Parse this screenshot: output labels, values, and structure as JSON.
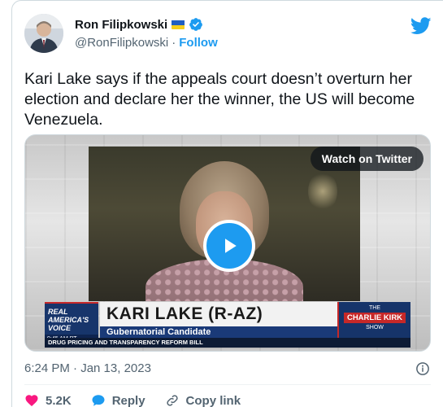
{
  "author": {
    "name": "Ron Filipkowski",
    "handle": "@RonFilipkowski",
    "separator": "·",
    "follow_label": "Follow"
  },
  "tweet": {
    "text": "Kari Lake says if the appeals court doesn’t overturn her election and declare her the winner, the US will become Venezuela.",
    "timestamp": "6:24 PM · Jan 13, 2023"
  },
  "media": {
    "watch_label": "Watch on Twitter",
    "chyron": {
      "network_line1": "REAL",
      "network_line2": "AMERICA'S",
      "network_line3": "VOICE",
      "time": "9:45 AM PT",
      "name": "KARI LAKE (R-AZ)",
      "subtitle": "Gubernatorial Candidate",
      "show_line1": "THE",
      "show_main": "CHARLIE KIRK",
      "show_line2": "SHOW",
      "ticker": "DRUG PRICING AND TRANSPARENCY REFORM BILL"
    }
  },
  "actions": {
    "likes": "5.2K",
    "reply_label": "Reply",
    "copy_label": "Copy link"
  },
  "colors": {
    "accent": "#1d9bf0",
    "like": "#f91880",
    "muted": "#536471"
  }
}
